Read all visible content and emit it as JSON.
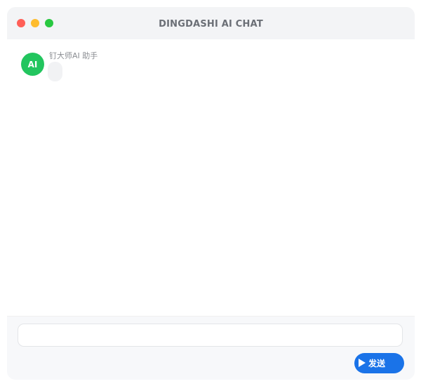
{
  "window": {
    "title": "DINGDASHI AI CHAT"
  },
  "chat": {
    "messages": [
      {
        "avatar_text": "AI",
        "sender": "钉大师AI 助手",
        "text": ""
      }
    ]
  },
  "composer": {
    "input_value": "",
    "send_label": "发送",
    "send_icon": "play-triangle-icon"
  },
  "colors": {
    "accent": "#1a73e8",
    "avatar": "#22c55e",
    "close": "#ff5f57",
    "minimize": "#febc2e",
    "maximize": "#28c840"
  }
}
